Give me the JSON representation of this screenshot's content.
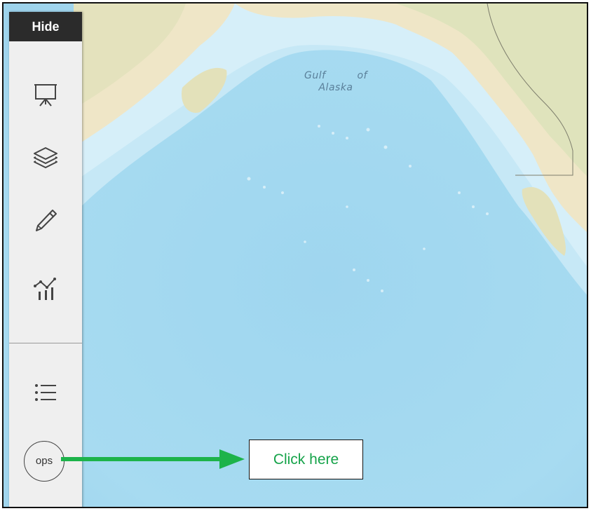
{
  "map": {
    "place_label": "Gulf of Alaska",
    "ocean_color": "#a4d8ef",
    "land_color": "#efe6c7"
  },
  "toolbar": {
    "hide_label": "Hide",
    "tools": [
      {
        "icon": "presentation-easel-icon"
      },
      {
        "icon": "layers-icon"
      },
      {
        "icon": "pencil-icon"
      },
      {
        "icon": "chart-trend-icon"
      },
      {
        "icon": "list-icon"
      }
    ],
    "ops_label": "ops"
  },
  "annotation": {
    "callout_text": "Click here",
    "arrow_color": "#1db34a",
    "text_color": "#16a34a"
  }
}
